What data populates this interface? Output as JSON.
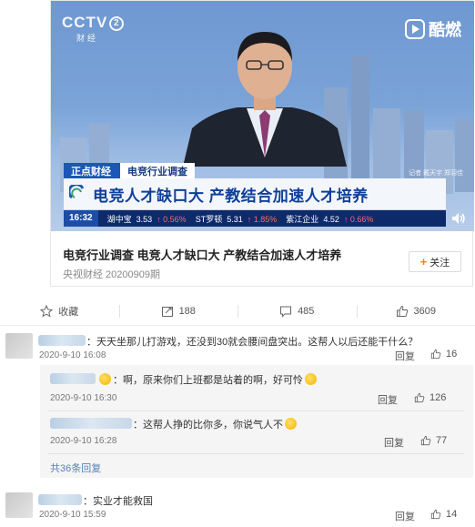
{
  "video": {
    "channel_logo": "CCTV",
    "channel_number": "2",
    "channel_sub": "财经",
    "brand": "酷燃",
    "reporter": "记者 戴天宇 郑羽佳",
    "tag_primary": "正点财经",
    "tag_secondary": "电竞行业调查",
    "headline": "电竞人才缺口大 产教结合加速人才培养",
    "ticker_time": "16:32",
    "ticker_items": [
      {
        "name": "湖中宝",
        "price": "3.53",
        "change": "↑ 0.56%"
      },
      {
        "name": "ST罗顿",
        "price": "5.31",
        "change": "↑ 1.85%"
      },
      {
        "name": "紫江企业",
        "price": "4.52",
        "change": "↑ 0.66%"
      }
    ],
    "title": "电竞行业调查 电竞人才缺口大 产教结合加速人才培养",
    "meta": "央视财经 20200909期",
    "follow_label": "关注"
  },
  "actions": {
    "favorite": "收藏",
    "repost": "188",
    "comment": "485",
    "like": "3609"
  },
  "comments": {
    "c1": {
      "text": "：天天坐那儿打游戏，还没到30就会腰间盘突出。这帮人以后还能干什么？",
      "date": "2020-9-10 16:08",
      "reply": "回复",
      "likes": "16"
    },
    "r1": {
      "text_a": "：啊，原来你们上班都是站着的啊，好可怜",
      "date": "2020-9-10 16:30",
      "reply": "回复",
      "likes": "126"
    },
    "r2": {
      "text_a": "：这帮人挣的比你多，你说气人不",
      "date": "2020-9-10 16:28",
      "reply": "回复",
      "likes": "77"
    },
    "more": "共36条回复",
    "c2": {
      "text": "：实业才能救国",
      "date": "2020-9-10 15:59",
      "reply": "回复",
      "likes": "14"
    }
  },
  "colors": {
    "accent": "#ff8200",
    "link": "#5a7fb5",
    "news_blue": "#1b57b6"
  }
}
